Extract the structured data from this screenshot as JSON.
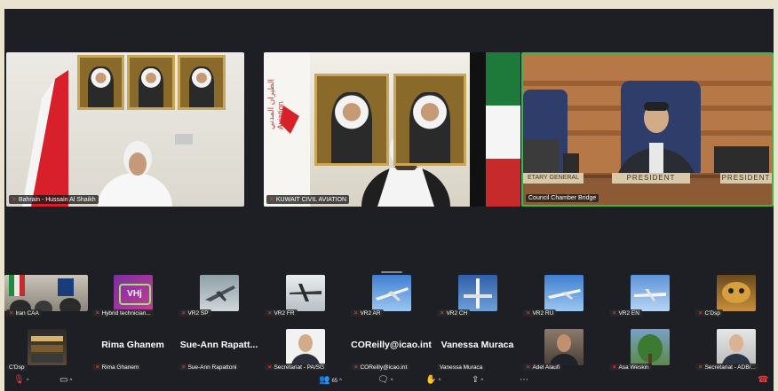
{
  "main_tiles": [
    {
      "label": "Bahrain - Hussain Al Shaikh"
    },
    {
      "label": "KUWAIT CIVIL AVIATION"
    },
    {
      "label": "Council Chamber Bridge"
    }
  ],
  "chamber_signs": {
    "left": "ETARY GENERAL",
    "center": "PRESIDENT",
    "right": "PRESIDENT"
  },
  "kuwait_banner": "الطيران المدني\nAviation",
  "row1": [
    {
      "label": "Iran CAA"
    },
    {
      "label": "Hybrid technician...",
      "avatar_text": "VHj"
    },
    {
      "label": "VR2 SP"
    },
    {
      "label": "VR2 FR"
    },
    {
      "label": "VR2 AR"
    },
    {
      "label": "VR2 CH"
    },
    {
      "label": "VR2 RU"
    },
    {
      "label": "VR2 EN"
    },
    {
      "label": "C'Dsp"
    }
  ],
  "row2": [
    {
      "label": "C'Dsp"
    },
    {
      "label": "Rima Ghanem",
      "name": "Rima Ghanem"
    },
    {
      "label": "Sue-Ann Rapattoni",
      "name": "Sue-Ann Rapatt..."
    },
    {
      "label": "Secretariat - PA/SG"
    },
    {
      "label": "COReilly@icao.int",
      "name": "COReilly@icao.int"
    },
    {
      "label": "Vanessa Muraca",
      "name": "Vanessa Muraca"
    },
    {
      "label": "Adel Alaufi"
    },
    {
      "label": "Asa Weskin"
    },
    {
      "label": "Secretariat - ADB/..."
    }
  ],
  "toolbar": {
    "participants_count": "65"
  },
  "colors": {
    "active_border": "#3db54a",
    "mute_red": "#e04040",
    "background": "#1e1f24"
  }
}
